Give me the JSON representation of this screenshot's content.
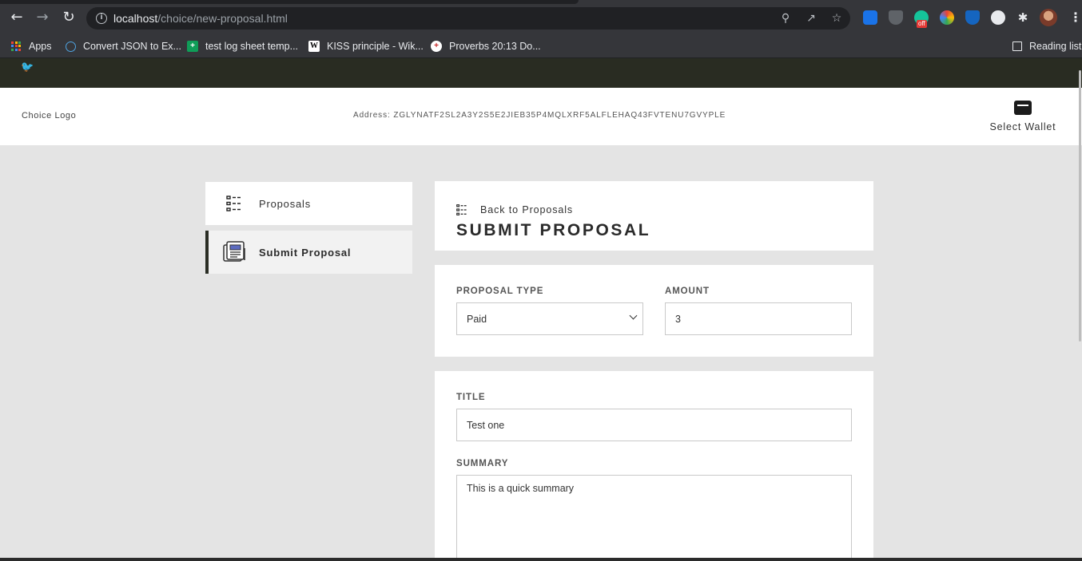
{
  "browser": {
    "url_host": "localhost",
    "url_path": "/choice/new-proposal.html",
    "extension_badge": "off",
    "bookmarks": [
      {
        "label": "Apps"
      },
      {
        "label": "Convert JSON to Ex..."
      },
      {
        "label": "test log sheet temp..."
      },
      {
        "label": "KISS principle - Wik..."
      },
      {
        "label": "Proverbs 20:13 Do..."
      }
    ],
    "reading_list": "Reading list"
  },
  "header": {
    "logo": "Choice Logo",
    "address": "Address: ZGLYNATF2SL2A3Y2S5E2JIEB35P4MQLXRF5ALFLEHAQ43FVTENU7GVYPLE",
    "wallet_label": "Select Wallet"
  },
  "sidebar": {
    "items": [
      {
        "label": "Proposals"
      },
      {
        "label": "Submit Proposal"
      }
    ]
  },
  "main": {
    "back_link": "Back to Proposals",
    "title": "SUBMIT PROPOSAL",
    "proposal_type_label": "PROPOSAL TYPE",
    "proposal_type_value": "Paid",
    "amount_label": "AMOUNT",
    "amount_value": "3",
    "title_label": "TITLE",
    "title_value": "Test one",
    "summary_label": "SUMMARY",
    "summary_value": "This is a quick summary"
  }
}
